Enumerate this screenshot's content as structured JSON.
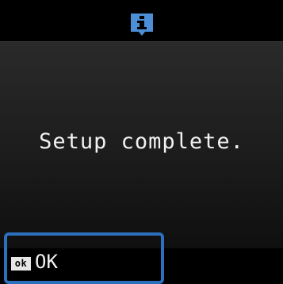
{
  "header": {
    "icon": "info-icon",
    "icon_color": "#4d8fd6"
  },
  "message": {
    "text": "Setup complete."
  },
  "footer": {
    "button_key": "OK",
    "button_label": "OK",
    "highlight_color": "#2c6fbd"
  }
}
